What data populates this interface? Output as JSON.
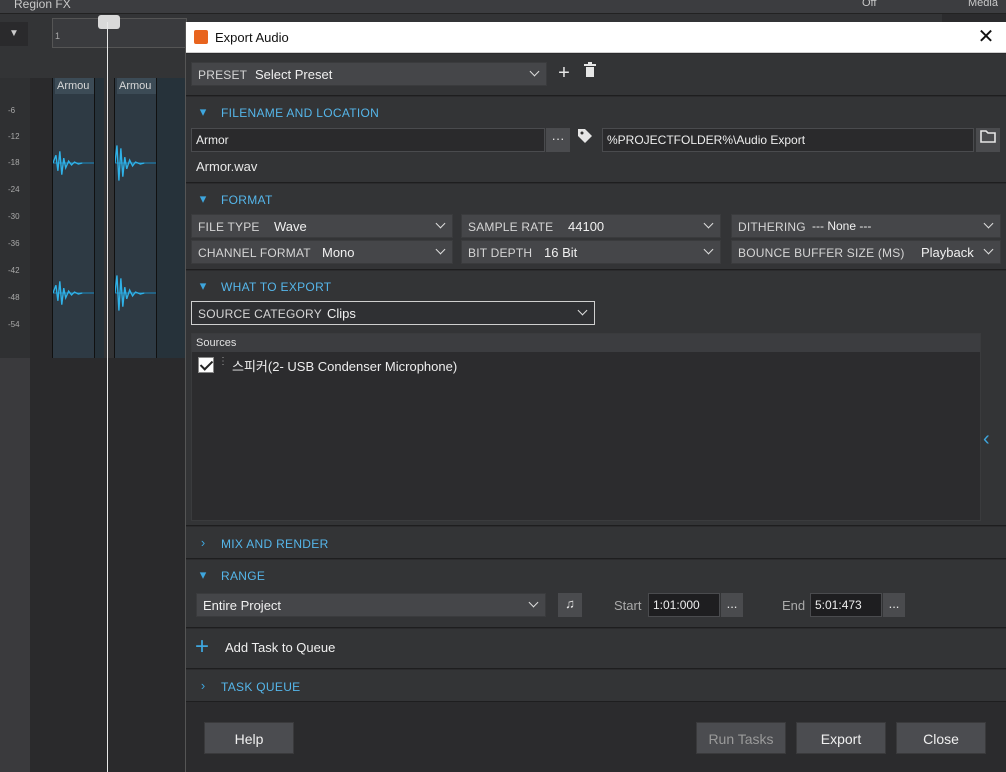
{
  "daw": {
    "region_fx": "Region FX",
    "off": "Off",
    "media": "Media",
    "ruler_start": "1",
    "clip_names": [
      "Armou",
      "Armou"
    ],
    "meter_ticks": [
      "-6",
      "-12",
      "-18",
      "-24",
      "-30",
      "-36",
      "-42",
      "-48",
      "-54"
    ]
  },
  "dialog": {
    "title": "Export Audio",
    "preset": {
      "label": "PRESET",
      "value": "Select Preset"
    },
    "filename_section": {
      "header": "FILENAME AND LOCATION",
      "filename": "Armor",
      "browse_dots": "···",
      "path": "%PROJECTFOLDER%\\Audio Export",
      "resolved": "Armor.wav"
    },
    "format_section": {
      "header": "FORMAT",
      "file_type": {
        "label": "FILE TYPE",
        "value": "Wave"
      },
      "sample_rate": {
        "label": "SAMPLE RATE",
        "value": "44100"
      },
      "dithering": {
        "label": "DITHERING",
        "value": "--- None ---"
      },
      "channel_format": {
        "label": "CHANNEL FORMAT",
        "value": "Mono"
      },
      "bit_depth": {
        "label": "BIT DEPTH",
        "value": "16 Bit"
      },
      "bounce_buffer": {
        "label": "BOUNCE BUFFER SIZE (MS)",
        "value": "Playback"
      }
    },
    "what_section": {
      "header": "WHAT TO EXPORT",
      "source_category": {
        "label": "SOURCE CATEGORY",
        "value": "Clips"
      },
      "sources_header": "Sources",
      "sources": [
        {
          "name": "스피커(2- USB Condenser Microphone)",
          "checked": true
        }
      ]
    },
    "mix_section": {
      "header": "MIX AND RENDER"
    },
    "range_section": {
      "header": "RANGE",
      "range_value": "Entire Project",
      "start_label": "Start",
      "start_value": "1:01:000",
      "end_label": "End",
      "end_value": "5:01:473",
      "dots": "..."
    },
    "add_task": "Add Task to Queue",
    "task_queue": {
      "header": "TASK QUEUE"
    },
    "buttons": {
      "help": "Help",
      "run_tasks": "Run Tasks",
      "export": "Export",
      "close": "Close"
    },
    "colors": {
      "accent": "#3ea6de",
      "section_header": "#55b6ea",
      "panel": "#333436"
    }
  }
}
